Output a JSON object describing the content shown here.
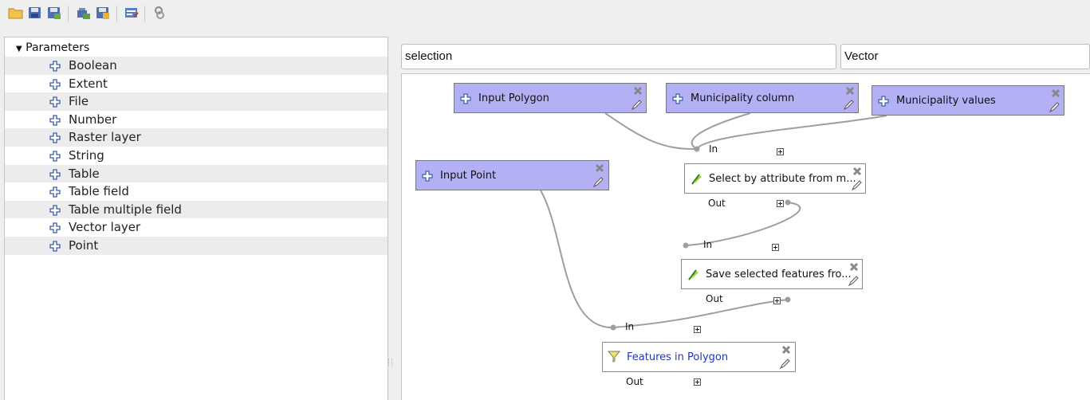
{
  "toolbar": {
    "buttons": [
      {
        "icon": "open-folder-icon"
      },
      {
        "icon": "save-icon"
      },
      {
        "icon": "save-as-icon"
      },
      {
        "icon": "export-image-icon"
      },
      {
        "icon": "export-python-icon"
      },
      {
        "icon": "edit-help-icon"
      },
      {
        "icon": "run-model-icon"
      }
    ]
  },
  "tree": {
    "root_label": "Parameters",
    "items": [
      "Boolean",
      "Extent",
      "File",
      "Number",
      "Raster layer",
      "String",
      "Table",
      "Table field",
      "Table multiple field",
      "Vector layer",
      "Point"
    ]
  },
  "model": {
    "name": "selection",
    "group": "Vector"
  },
  "graph": {
    "inputs": [
      {
        "label": "Input Polygon"
      },
      {
        "label": "Municipality column"
      },
      {
        "label": "Municipality values"
      },
      {
        "label": "Input Point"
      }
    ],
    "algorithms": [
      {
        "label": "Select by attribute from m...",
        "in": "In",
        "out": "Out"
      },
      {
        "label": "Save selected features fro...",
        "in": "In",
        "out": "Out"
      },
      {
        "label": "Features in Polygon",
        "in": "In",
        "out": "Out",
        "label_color": "#1f35c9"
      }
    ]
  },
  "colors": {
    "param_fill": "#b3b0f4",
    "link_color": "#9e9e9e",
    "accent_text": "#1f35c9"
  }
}
